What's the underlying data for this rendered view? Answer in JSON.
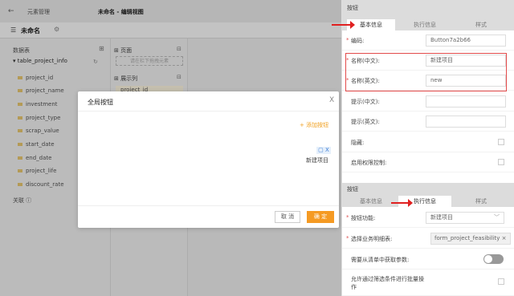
{
  "topbar": {
    "back": "←",
    "crumb1": "元素管理",
    "crumb2": "未命名 - 编辑视图"
  },
  "subbar": {
    "name": "未命名"
  },
  "left": {
    "header": "数据表",
    "table": "▾ table_project_info",
    "fields": [
      "project_id",
      "project_name",
      "investment",
      "project_type",
      "scrap_value",
      "start_date",
      "end_date",
      "project_life",
      "discount_rate"
    ],
    "relation": "关联 ⓘ"
  },
  "mid": {
    "page_label": "⊞ 页面",
    "drop_hint": "请在栏下拖拽元素",
    "display_label": "⊞ 展示列",
    "row": "project_id"
  },
  "modal": {
    "title": "全局按钮",
    "close": "X",
    "add": "+ 添加按钮",
    "chip_icons": "▢ X",
    "chip_label": "新建项目",
    "cancel": "取 消",
    "ok": "确 定"
  },
  "panel1": {
    "header": "按钮",
    "tabs": [
      "基本信息",
      "执行信息",
      "样式"
    ],
    "rows": [
      {
        "required": true,
        "label": "编码:",
        "value": "Button7a2b66"
      },
      {
        "required": true,
        "label": "名称(中文):",
        "value": "新建项目"
      },
      {
        "required": true,
        "label": "名称(英文):",
        "value": "new"
      },
      {
        "required": false,
        "label": "提示(中文):",
        "value": ""
      },
      {
        "required": false,
        "label": "提示(英文):",
        "value": ""
      },
      {
        "required": false,
        "label": "隐藏:",
        "checked": false
      },
      {
        "required": false,
        "label": "启用权限控制:",
        "checked": false
      }
    ]
  },
  "panel2": {
    "header": "按钮",
    "tabs": [
      "基本信息",
      "执行信息",
      "样式"
    ],
    "rows": [
      {
        "required": true,
        "label": "按钮功能:",
        "value": "新建项目"
      },
      {
        "required": true,
        "label": "选择业务明细表:",
        "value": "form_project_feasibility ×"
      },
      {
        "required": false,
        "label": "需要从清单中获取参数:",
        "toggle": false
      },
      {
        "required": false,
        "label": "允许通过筛选条件进行批量操作",
        "checked": false
      }
    ]
  },
  "colors": {
    "accent": "#f59a23",
    "highlight": "#e34a4a"
  }
}
